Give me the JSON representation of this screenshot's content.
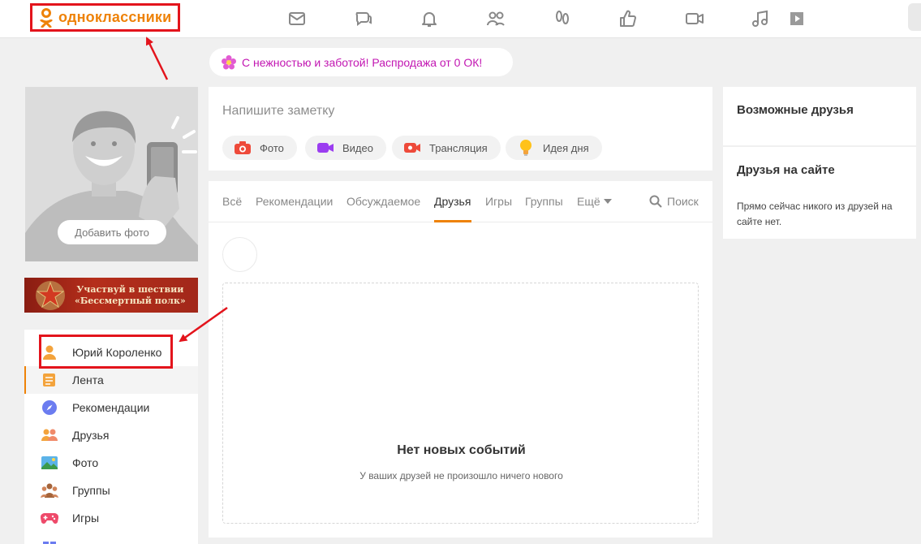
{
  "brand": {
    "name": "одноклассники",
    "accent": "#ee8208",
    "highlight": "#e3141c"
  },
  "header": {
    "nav_icons": [
      "messages-icon",
      "discussions-icon",
      "notifications-icon",
      "friends-icon",
      "guests-icon",
      "likes-icon",
      "video-icon",
      "music-icon",
      "games-icon"
    ]
  },
  "promo": {
    "text": "С нежностью и заботой! Распродажа от 0 ОК!"
  },
  "profile": {
    "add_photo": "Добавить фото"
  },
  "banner": {
    "line1": "Участвуй в шествии",
    "line2": "«Бессмертный полк»"
  },
  "menu": {
    "items": [
      {
        "label": "Юрий Короленко",
        "icon": "user-icon"
      },
      {
        "label": "Лента",
        "icon": "feed-icon"
      },
      {
        "label": "Рекомендации",
        "icon": "compass-icon"
      },
      {
        "label": "Друзья",
        "icon": "friends-icon"
      },
      {
        "label": "Фото",
        "icon": "photo-icon"
      },
      {
        "label": "Группы",
        "icon": "groups-icon"
      },
      {
        "label": "Игры",
        "icon": "gamepad-icon"
      }
    ]
  },
  "composer": {
    "placeholder": "Напишите заметку",
    "chips": [
      "Фото",
      "Видео",
      "Трансляция",
      "Идея дня"
    ]
  },
  "feed": {
    "tabs": [
      "Всё",
      "Рекомендации",
      "Обсуждаемое",
      "Друзья",
      "Игры",
      "Группы",
      "Ещё"
    ],
    "active_tab": "Друзья",
    "search": "Поиск",
    "empty_title": "Нет новых событий",
    "empty_sub": "У ваших друзей не произошло ничего нового"
  },
  "right": {
    "possible_friends": "Возможные друзья",
    "friends_online": "Друзья на сайте",
    "friends_online_text": "Прямо сейчас никого из друзей на сайте нет."
  }
}
